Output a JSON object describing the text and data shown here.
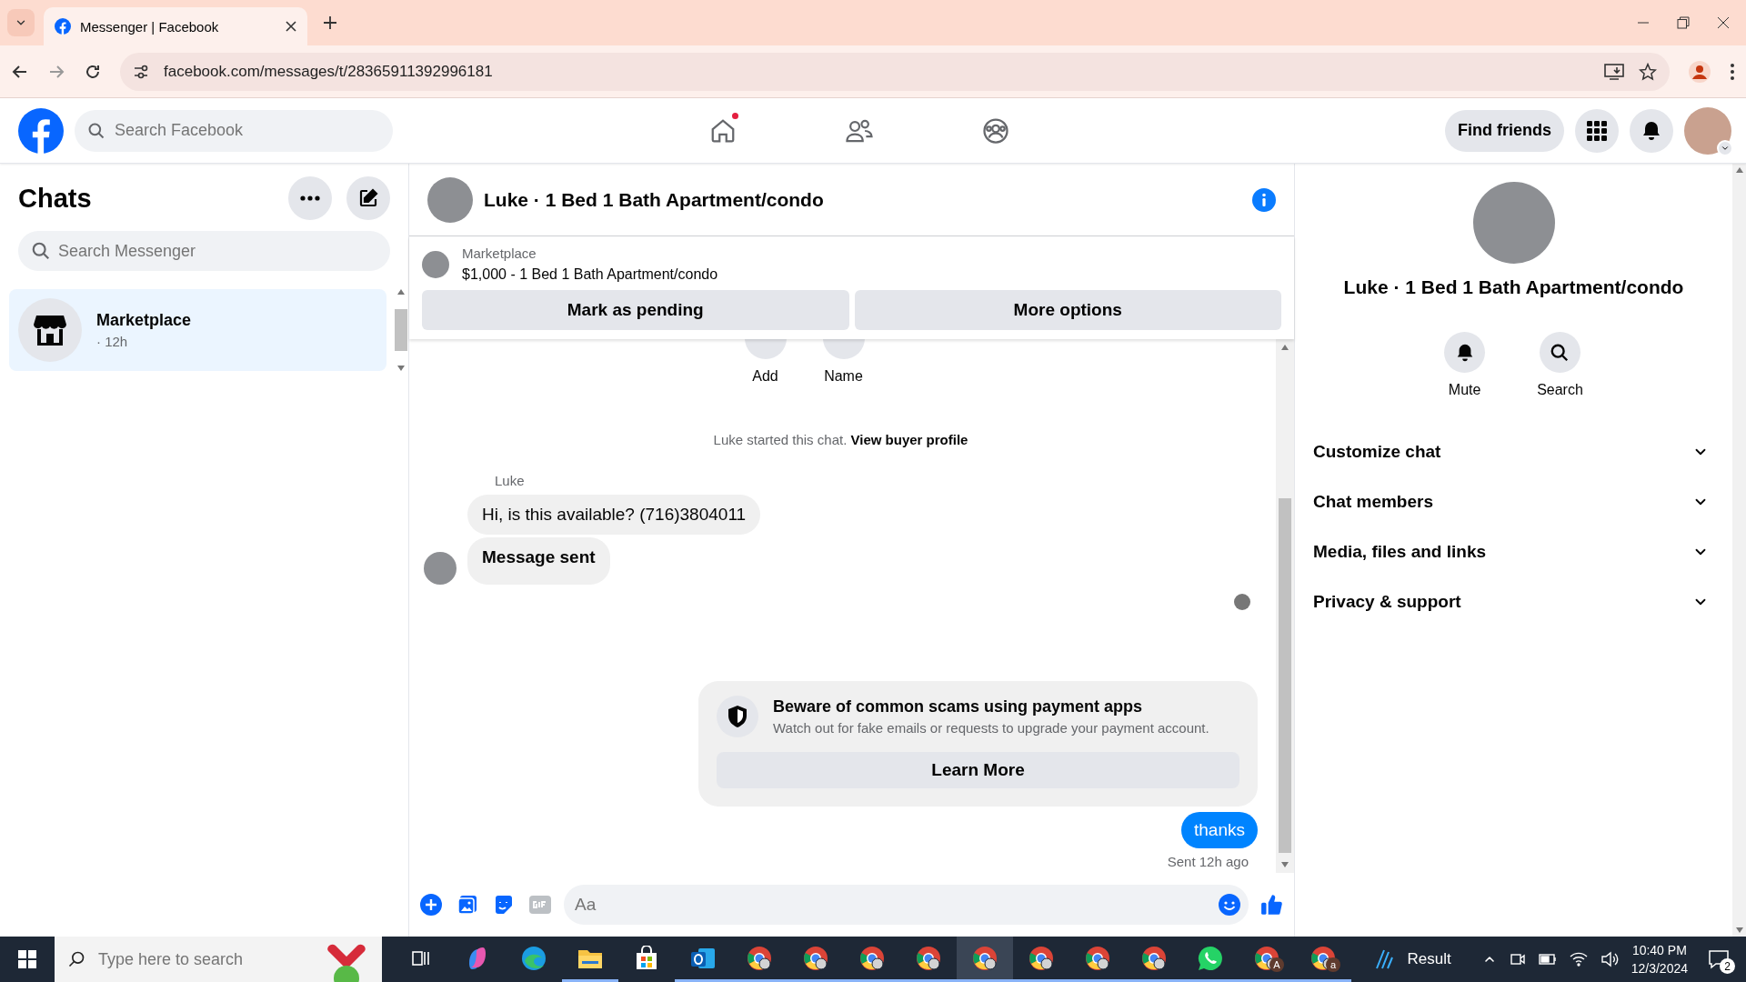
{
  "browser": {
    "tab_title": "Messenger | Facebook",
    "url": "facebook.com/messages/t/28365911392996181"
  },
  "top_nav": {
    "search_placeholder": "Search Facebook",
    "nav_items": [
      {
        "kind": "home",
        "badge": true
      },
      {
        "kind": "friends",
        "badge": false
      },
      {
        "kind": "groups",
        "badge": false
      }
    ],
    "find_friends": "Find friends"
  },
  "chats": {
    "title": "Chats",
    "search_placeholder": "Search Messenger",
    "items": [
      {
        "name": "Marketplace",
        "time": "· 12h",
        "selected": true
      }
    ]
  },
  "conversation": {
    "title": "Luke · 1 Bed 1 Bath Apartment/condo",
    "listing": {
      "label": "Marketplace",
      "text": "$1,000 - 1 Bed 1 Bath Apartment/condo"
    },
    "actions": [
      "Mark as pending",
      "More options"
    ],
    "quick_actions": [
      "Add",
      "Name"
    ],
    "system_note": {
      "text": "Luke started this chat.",
      "link": "View buyer profile"
    },
    "messages": [
      {
        "kind": "incoming",
        "sender": "Luke",
        "text": "Hi, is this available? (716)3804011",
        "bold": false
      },
      {
        "kind": "incoming",
        "text": "Message sent",
        "bold": true
      },
      {
        "kind": "notice",
        "title": "Beware of common scams using payment apps",
        "text": "Watch out for fake emails or requests to upgrade your payment account.",
        "button": "Learn More"
      },
      {
        "kind": "outgoing",
        "text": "thanks",
        "bold": false
      }
    ],
    "status": "Sent 12h ago",
    "composer_placeholder": "Aa"
  },
  "details": {
    "title": "Luke · 1 Bed 1 Bath Apartment/condo",
    "actions": [
      {
        "kind": "mute",
        "label": "Mute"
      },
      {
        "kind": "search",
        "label": "Search"
      }
    ],
    "sections": [
      {
        "label": "Customize chat",
        "expanded": false
      },
      {
        "label": "Chat members",
        "expanded": false
      },
      {
        "label": "Media, files and links",
        "expanded": false
      },
      {
        "label": "Privacy & support",
        "expanded": false
      }
    ]
  },
  "taskbar": {
    "search_placeholder": "Type here to search",
    "apps": [
      {
        "kind": "taskview",
        "active": false
      },
      {
        "kind": "copilot",
        "active": false
      },
      {
        "kind": "edge",
        "active": false
      },
      {
        "kind": "explorer",
        "active": false
      },
      {
        "kind": "store",
        "active": false
      },
      {
        "kind": "outlook",
        "active": false
      },
      {
        "kind": "chrome",
        "active": false
      },
      {
        "kind": "chrome",
        "active": false
      },
      {
        "kind": "chrome",
        "active": false
      },
      {
        "kind": "chrome",
        "active": false
      },
      {
        "kind": "chrome",
        "active": true
      },
      {
        "kind": "chrome",
        "active": false
      },
      {
        "kind": "chrome",
        "active": false
      },
      {
        "kind": "chrome",
        "active": false
      },
      {
        "kind": "whatsapp",
        "active": false
      },
      {
        "kind": "chrome",
        "badge": "A",
        "active": false
      },
      {
        "kind": "chrome",
        "badge": "a",
        "active": false
      }
    ],
    "weather": "Result",
    "time": "10:40 PM",
    "date": "12/3/2024",
    "notifications": "2"
  }
}
